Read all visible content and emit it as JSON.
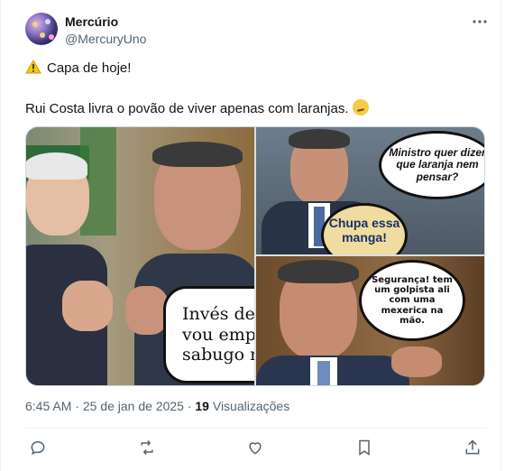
{
  "post": {
    "author_name": "Mercúrio",
    "author_handle": "@MercuryUno",
    "text_line1": "Capa de hoje!",
    "text_line2": "Rui Costa livra o povão de viver apenas com laranjas.",
    "time": "6:45 AM",
    "date": "25 de jan de 2025",
    "views_count": "19",
    "views_label": "Visualizações"
  },
  "media": {
    "left_bubble": "Invés de m\nvou empu\nsabugo no",
    "top_right_bubble": "Ministro quer dizer que laranja nem pensar?",
    "top_right_bubble2": "Chupa essa manga!",
    "bottom_right_bubble": "Segurança! tem um golpista ali com uma mexerica na mão."
  },
  "icons": {
    "more": "more-dots-icon",
    "warning": "warning-emoji-icon",
    "smirk": "smirking-emoji-icon",
    "reply": "reply-icon",
    "repost": "repost-icon",
    "like": "like-icon",
    "bookmark": "bookmark-icon",
    "share": "share-icon"
  },
  "colors": {
    "text_primary": "#0f1419",
    "text_secondary": "#536471",
    "border": "#cfd9de"
  }
}
